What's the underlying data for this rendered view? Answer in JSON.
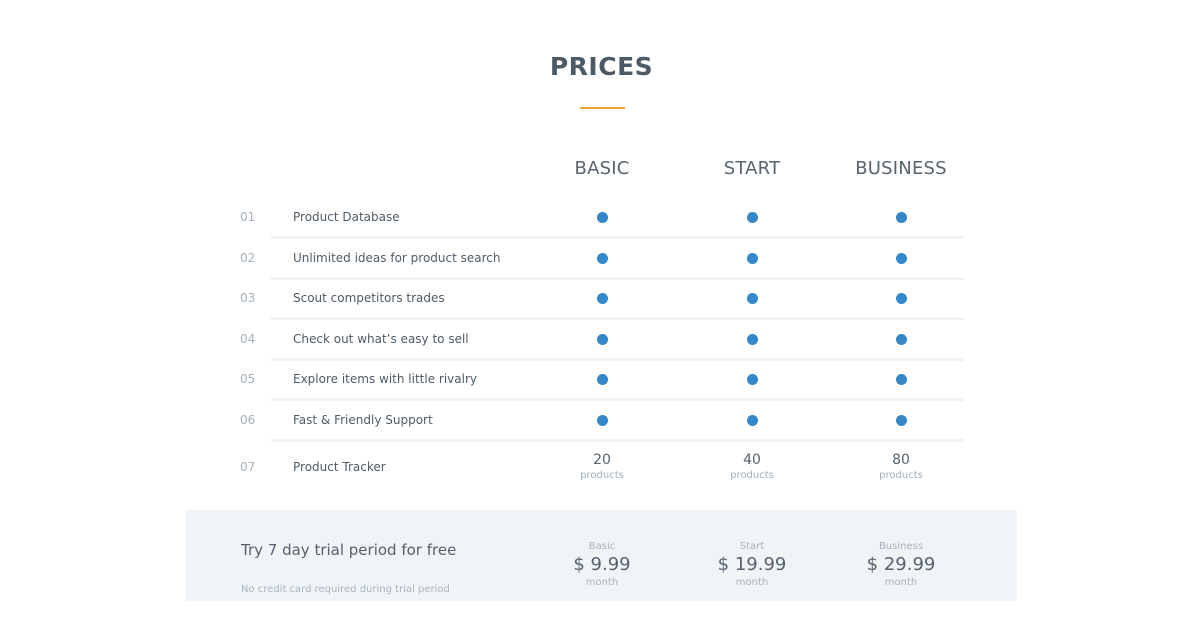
{
  "header": {
    "title": "PRICES",
    "accent_color": "#f0a732"
  },
  "plans": [
    {
      "name": "BASIC"
    },
    {
      "name": "START"
    },
    {
      "name": "BUSINESS"
    }
  ],
  "features": [
    {
      "num": "01",
      "label": "Product Database",
      "included": [
        true,
        true,
        true
      ]
    },
    {
      "num": "02",
      "label": "Unlimited ideas for product search",
      "included": [
        true,
        true,
        true
      ]
    },
    {
      "num": "03",
      "label": "Scout competitors trades",
      "included": [
        true,
        true,
        true
      ]
    },
    {
      "num": "04",
      "label": "Check out what’s easy to sell",
      "included": [
        true,
        true,
        true
      ]
    },
    {
      "num": "05",
      "label": "Explore items with little rivalry",
      "included": [
        true,
        true,
        true
      ]
    },
    {
      "num": "06",
      "label": "Fast & Friendly Support",
      "included": [
        true,
        true,
        true
      ]
    }
  ],
  "tracker": {
    "num": "07",
    "label": "Product Tracker",
    "values": [
      {
        "amount": "20",
        "unit": "products"
      },
      {
        "amount": "40",
        "unit": "products"
      },
      {
        "amount": "80",
        "unit": "products"
      }
    ]
  },
  "footer": {
    "trial_title": "Try 7 day trial period for free",
    "trial_note": "No credit card required during trial period",
    "prices": [
      {
        "plan": "Basic",
        "price": "$ 9.99",
        "period": "month"
      },
      {
        "plan": "Start",
        "price": "$ 19.99",
        "period": "month"
      },
      {
        "plan": "Business",
        "price": "$ 29.99",
        "period": "month"
      }
    ]
  },
  "colors": {
    "dot": "#3487c8",
    "footer_bg": "#f1f4f7"
  }
}
